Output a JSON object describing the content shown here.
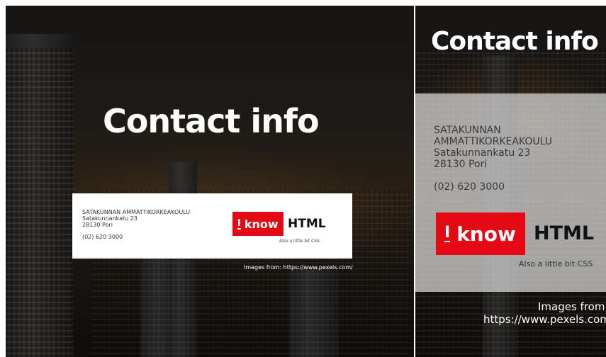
{
  "colors": {
    "accent": "#e50914",
    "card_bg": "#ffffff",
    "heading": "#ffffff"
  },
  "contact": {
    "heading": "Contact info",
    "school_name": "SATAKUNNAN AMMATTIKORKEAKOULU",
    "school_name_line1": "SATAKUNNAN",
    "school_name_line2": "AMMATTIKORKEAKOULU",
    "street": "Satakunnankatu 23",
    "postal": "28130 Pori",
    "phone": "(02) 620 3000"
  },
  "logo": {
    "i_letter": "I",
    "know_word": "know",
    "html_word": "HTML",
    "tagline": "Also a little bit CSS"
  },
  "credits": {
    "full": "Images from: https://www.pexels.com/",
    "line1": "Images from:",
    "line2": "https://www.pexels.com/"
  }
}
